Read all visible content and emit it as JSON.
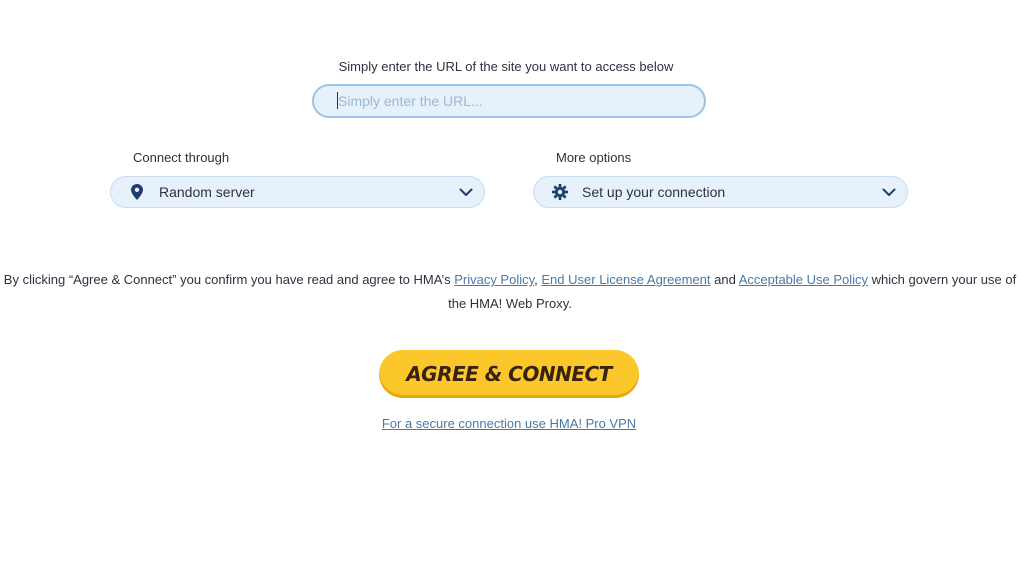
{
  "url_section": {
    "label": "Simply enter the URL of the site you want to access below",
    "input_placeholder": "Simply enter the URL...",
    "input_value": ""
  },
  "connect_through": {
    "label": "Connect through",
    "selected": "Random server",
    "icon": "location-pin-icon"
  },
  "more_options": {
    "label": "More options",
    "selected": "Set up your connection",
    "icon": "gear-icon"
  },
  "consent": {
    "text_1": "By clicking “Agree & Connect” you confirm you have read and agree to HMA’s ",
    "privacy_link": "Privacy Policy",
    "separator": ", ",
    "eula_link": "End User License Agreement",
    "and_text": " and ",
    "aup_link": "Acceptable Use Policy",
    "text_2": " which govern your use of the HMA! Web Proxy."
  },
  "cta": {
    "label": "AGREE & CONNECT"
  },
  "pro_link": {
    "label": "For a secure connection use HMA! Pro VPN"
  },
  "colors": {
    "accent_yellow": "#fcc72a",
    "field_bg": "#e6f1fc",
    "link": "#4a79a8",
    "icon_navy": "#1f3f6b"
  }
}
